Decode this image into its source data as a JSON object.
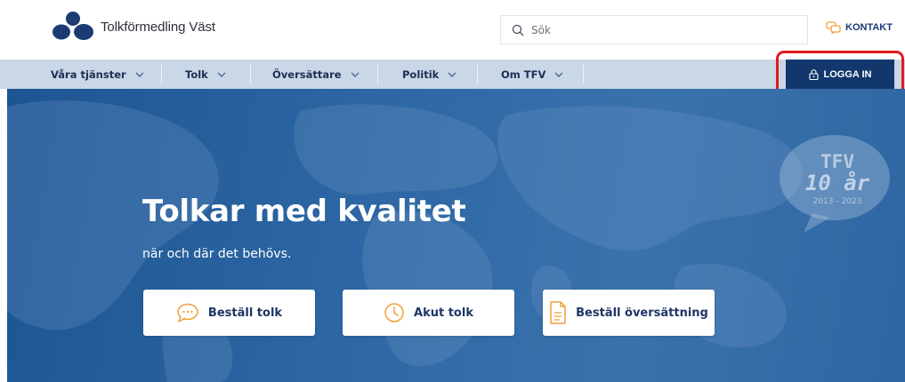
{
  "header": {
    "brand_name": "Tolkförmedling Väst",
    "search_placeholder": "Sök",
    "search_icon": "search-icon",
    "contact_label": "KONTAKT",
    "contact_icon": "chat-bubbles-icon"
  },
  "nav": {
    "items": [
      {
        "label": "Våra tjänster"
      },
      {
        "label": "Tolk"
      },
      {
        "label": "Översättare"
      },
      {
        "label": "Politik"
      },
      {
        "label": "Om TFV"
      }
    ],
    "login_label": "LOGGA IN",
    "login_icon": "lock-icon"
  },
  "hero": {
    "title": "Tolkar med kvalitet",
    "subtitle": "när och där det behövs.",
    "badge": {
      "line1": "TFV",
      "line2": "10 år",
      "line3": "2013 - 2023"
    },
    "buttons": [
      {
        "label": "Beställ tolk",
        "icon": "speech-bubble-icon"
      },
      {
        "label": "Akut tolk",
        "icon": "clock-icon"
      },
      {
        "label": "Beställ översättning",
        "icon": "document-icon"
      }
    ]
  },
  "colors": {
    "brand_navy": "#12376d",
    "nav_background": "#c9d7e7",
    "icon_orange": "#f0a13a",
    "highlight_red": "#e31b1b"
  }
}
